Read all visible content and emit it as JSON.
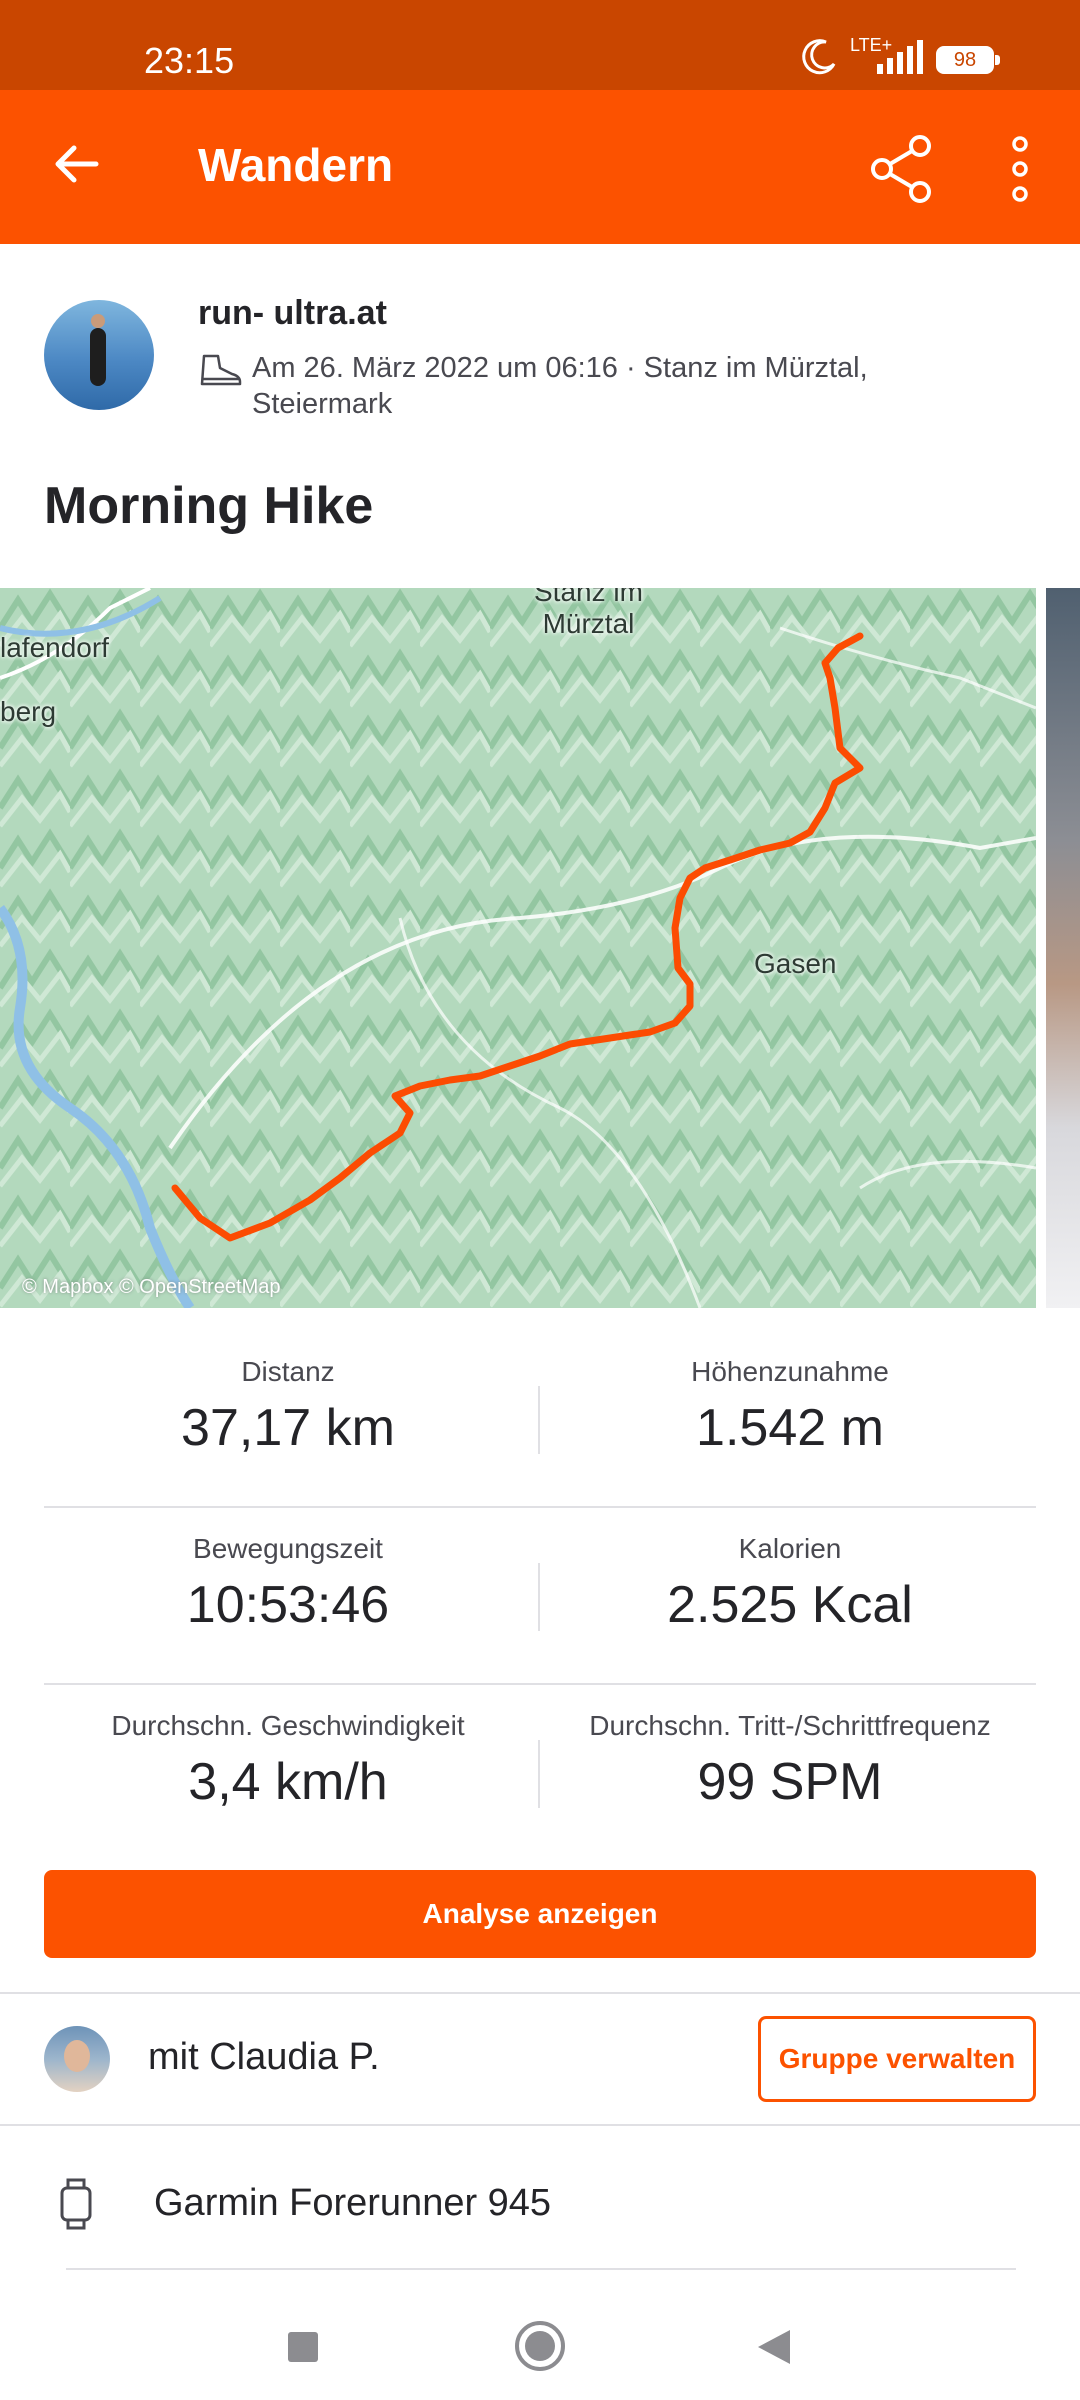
{
  "status_bar": {
    "time": "23:15",
    "network": "LTE+",
    "battery": "98"
  },
  "app_bar": {
    "title": "Wandern"
  },
  "athlete": {
    "name": "run- ultra.at",
    "meta": "Am 26. März 2022 um 06:16 · Stanz im Mürztal, Steiermark"
  },
  "activity": {
    "title": "Morning Hike"
  },
  "map": {
    "labels": {
      "town_top": "Stanz im\nMürztal",
      "town_left": "lafendorf",
      "town_left2": "berg",
      "gasen": "Gasen"
    },
    "attribution": "© Mapbox © OpenStreetMap",
    "route_color": "#fc4c02"
  },
  "stats": {
    "distance": {
      "label": "Distanz",
      "value": "37,17 km"
    },
    "elevation": {
      "label": "Höhenzunahme",
      "value": "1.542 m"
    },
    "moving_time": {
      "label": "Bewegungszeit",
      "value": "10:53:46"
    },
    "calories": {
      "label": "Kalorien",
      "value": "2.525 Kcal"
    },
    "avg_speed": {
      "label": "Durchschn. Geschwindigkeit",
      "value": "3,4 km/h"
    },
    "avg_cadence": {
      "label": "Durchschn. Tritt-/Schrittfrequenz",
      "value": "99 SPM"
    }
  },
  "analyse_button": "Analyse anzeigen",
  "group": {
    "with_text": "mit Claudia P.",
    "manage_button": "Gruppe verwalten"
  },
  "device": {
    "name": "Garmin Forerunner 945"
  },
  "colors": {
    "accent": "#fc5200",
    "status_bar": "#c94600"
  }
}
